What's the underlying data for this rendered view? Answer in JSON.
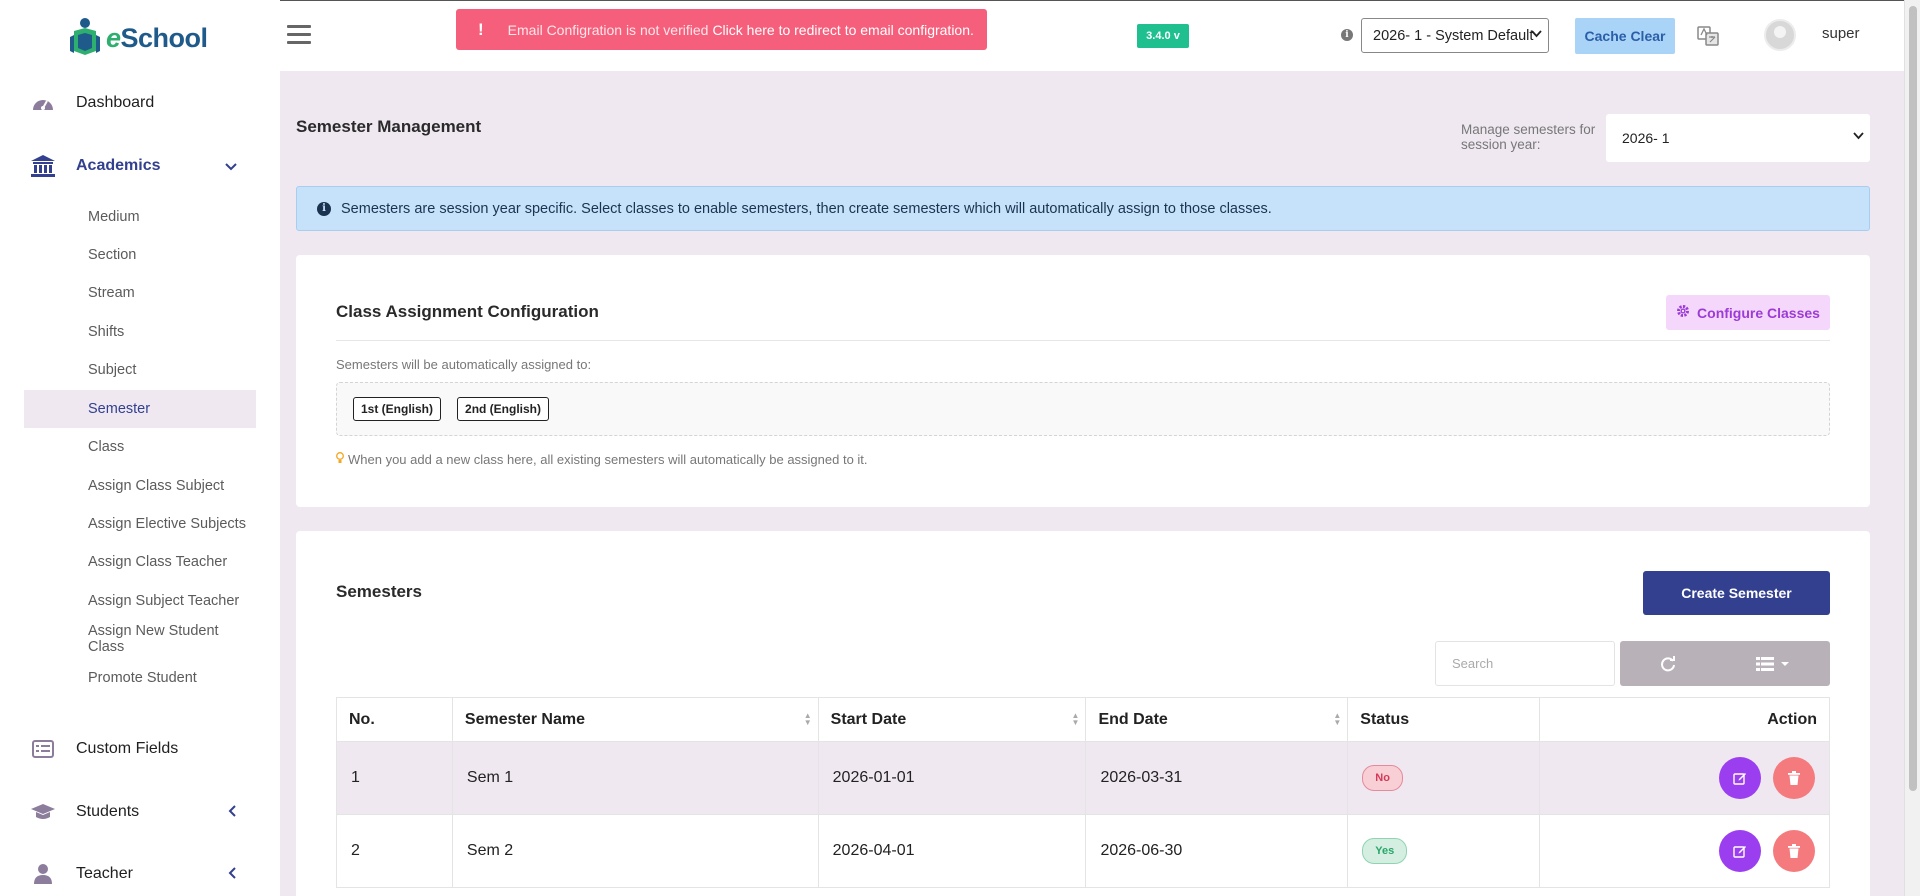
{
  "brand": {
    "name_prefix": "e",
    "name_rest": "School"
  },
  "sidebar": {
    "dashboard": "Dashboard",
    "academics": "Academics",
    "academics_items": [
      "Medium",
      "Section",
      "Stream",
      "Shifts",
      "Subject",
      "Semester",
      "Class",
      "Assign Class Subject",
      "Assign Elective Subjects",
      "Assign Class Teacher",
      "Assign Subject Teacher",
      "Assign New Student Class",
      "Promote Student"
    ],
    "active_item": "Semester",
    "custom_fields": "Custom Fields",
    "students": "Students",
    "teacher": "Teacher"
  },
  "header": {
    "alert_icon": "!",
    "alert_text": "Email Configration is not verified",
    "alert_link": "Click here to redirect to email configration.",
    "version": "3.4.0 v",
    "info_icon": "i",
    "session_select": "2026- 1 - System Default",
    "cache_clear": "Cache Clear",
    "user_name": "super"
  },
  "page": {
    "title": "Semester Management",
    "manage_label": "Manage semesters for session year:",
    "manage_select": "2026- 1",
    "info_banner": "Semesters are session year specific. Select classes to enable semesters, then create semesters which will automatically assign to those classes."
  },
  "class_assignment": {
    "title": "Class Assignment Configuration",
    "configure_button": "Configure Classes",
    "assigned_label": "Semesters will be automatically assigned to:",
    "classes": [
      "1st (English)",
      "2nd (English)"
    ],
    "hint": "When you add a new class here, all existing semesters will automatically be assigned to it."
  },
  "semesters": {
    "title": "Semesters",
    "create_button": "Create Semester",
    "search_placeholder": "Search",
    "columns": [
      "No.",
      "Semester Name",
      "Start Date",
      "End Date",
      "Status",
      "Action"
    ],
    "rows": [
      {
        "no": "1",
        "name": "Sem 1",
        "start": "2026-01-01",
        "end": "2026-03-31",
        "status": "No"
      },
      {
        "no": "2",
        "name": "Sem 2",
        "start": "2026-04-01",
        "end": "2026-06-30",
        "status": "Yes"
      }
    ]
  },
  "colors": {
    "primary": "#32408f",
    "alert": "#f55f7b",
    "version_badge": "#1fbf8f",
    "cache_button": "#a9d4f7",
    "page_background": "#efe8f1",
    "edit_button": "#9b3ef0",
    "delete_button": "#f47a7d"
  }
}
